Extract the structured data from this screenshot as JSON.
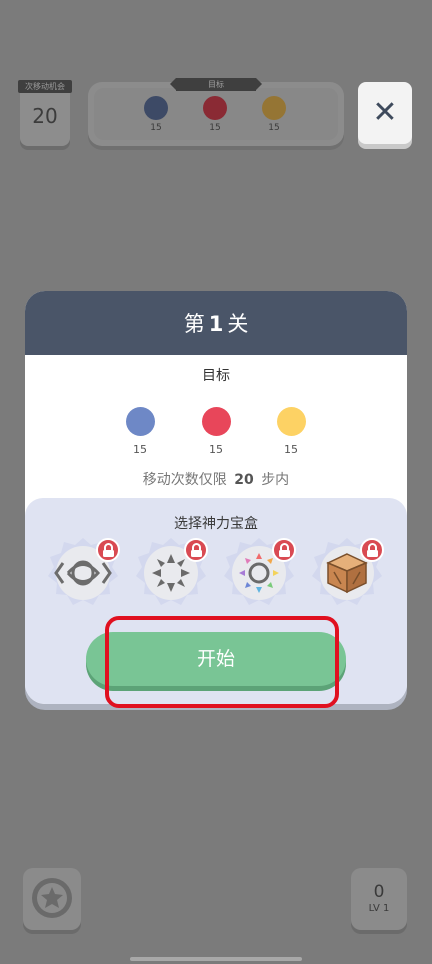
{
  "hud": {
    "moves_label": "次移动机会",
    "moves_value": "20",
    "goals_label": "目标",
    "goals": [
      {
        "color": "#3d4a66",
        "count": "15"
      },
      {
        "color": "#8a2a34",
        "count": "15"
      },
      {
        "color": "#957534",
        "count": "15"
      }
    ],
    "close_icon": "close-icon"
  },
  "modal": {
    "title_prefix": "第",
    "title_number": "1",
    "title_suffix": "关",
    "goal_title": "目标",
    "goals": [
      {
        "color": "#6e88c6",
        "count": "15"
      },
      {
        "color": "#e8465a",
        "count": "15"
      },
      {
        "color": "#fdd264",
        "count": "15"
      }
    ],
    "moves_limit_prefix": "移动次数仅限",
    "moves_limit_value": "20",
    "moves_limit_suffix": "步内",
    "box_title": "选择神力宝盒",
    "boosters": [
      {
        "icon": "eye-swap-icon",
        "locked": true
      },
      {
        "icon": "spike-burst-icon",
        "locked": true
      },
      {
        "icon": "rainbow-ring-icon",
        "locked": true
      },
      {
        "icon": "wooden-crate-icon",
        "locked": true
      }
    ],
    "start_label": "开始"
  },
  "bottom": {
    "star_icon": "star-icon",
    "level_count": "0",
    "level_label": "LV 1"
  },
  "colors": {
    "overlay_bg": "#7b7b7b",
    "header": "#4a5568",
    "start_button": "#79c595",
    "highlight": "#e01020",
    "lock": "#d94a52"
  }
}
